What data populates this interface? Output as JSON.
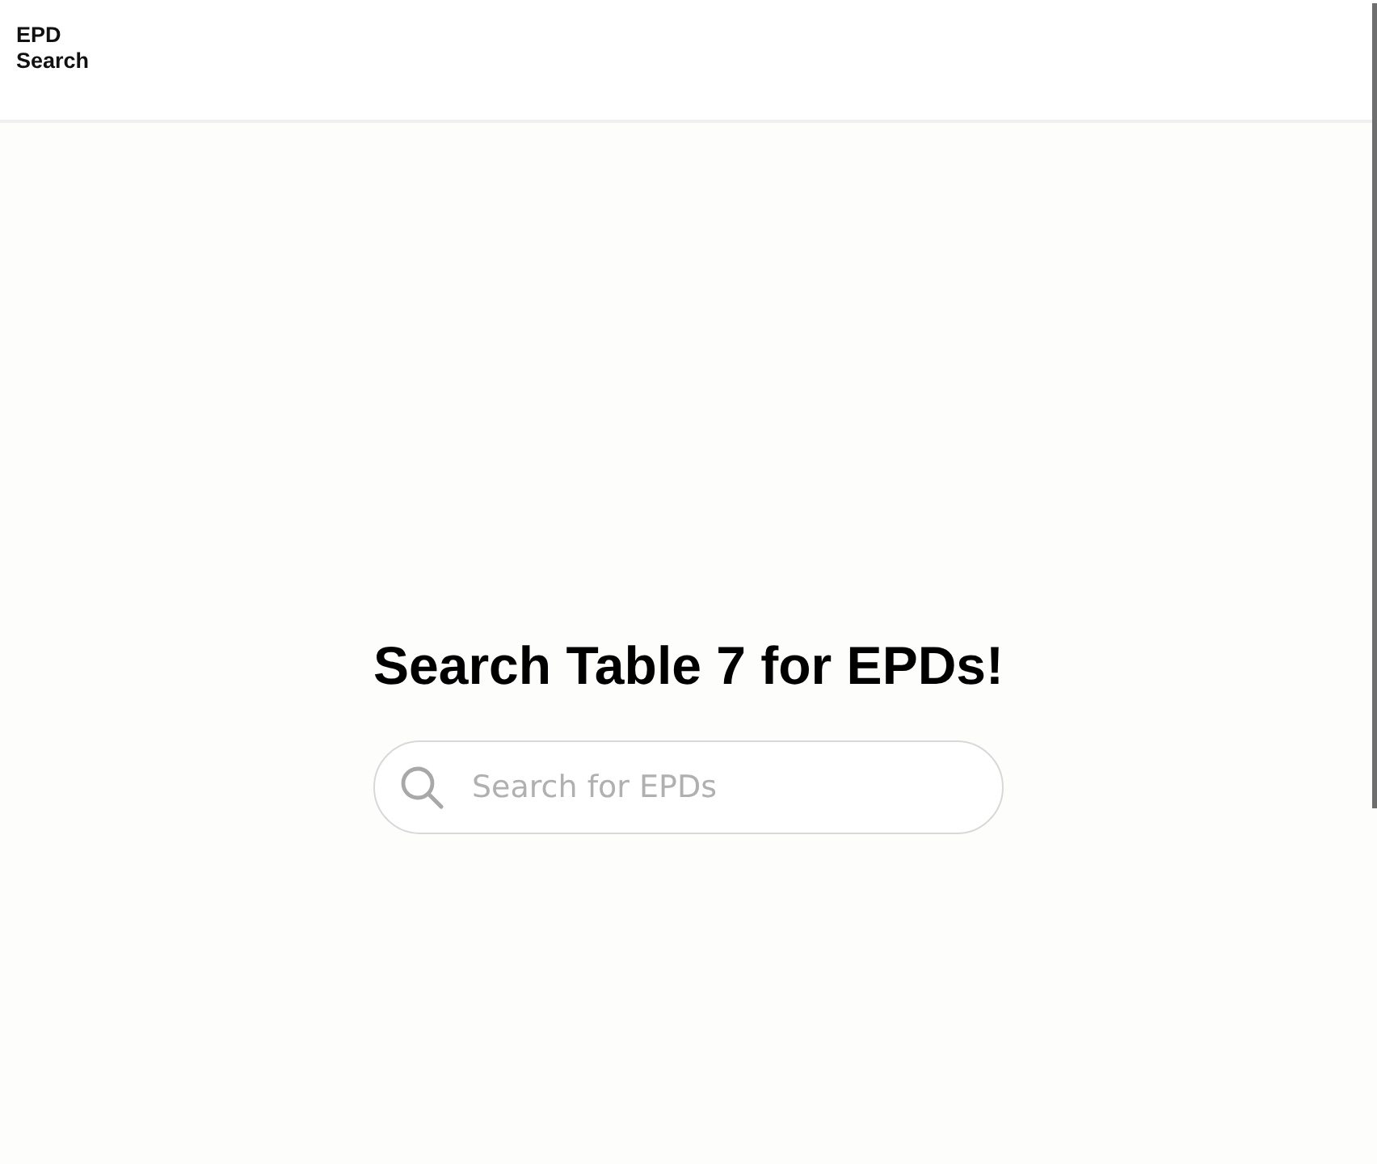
{
  "header": {
    "logo": "EPD Search"
  },
  "main": {
    "heading": "Search Table 7 for EPDs!",
    "search": {
      "placeholder": "Search for EPDs"
    }
  }
}
